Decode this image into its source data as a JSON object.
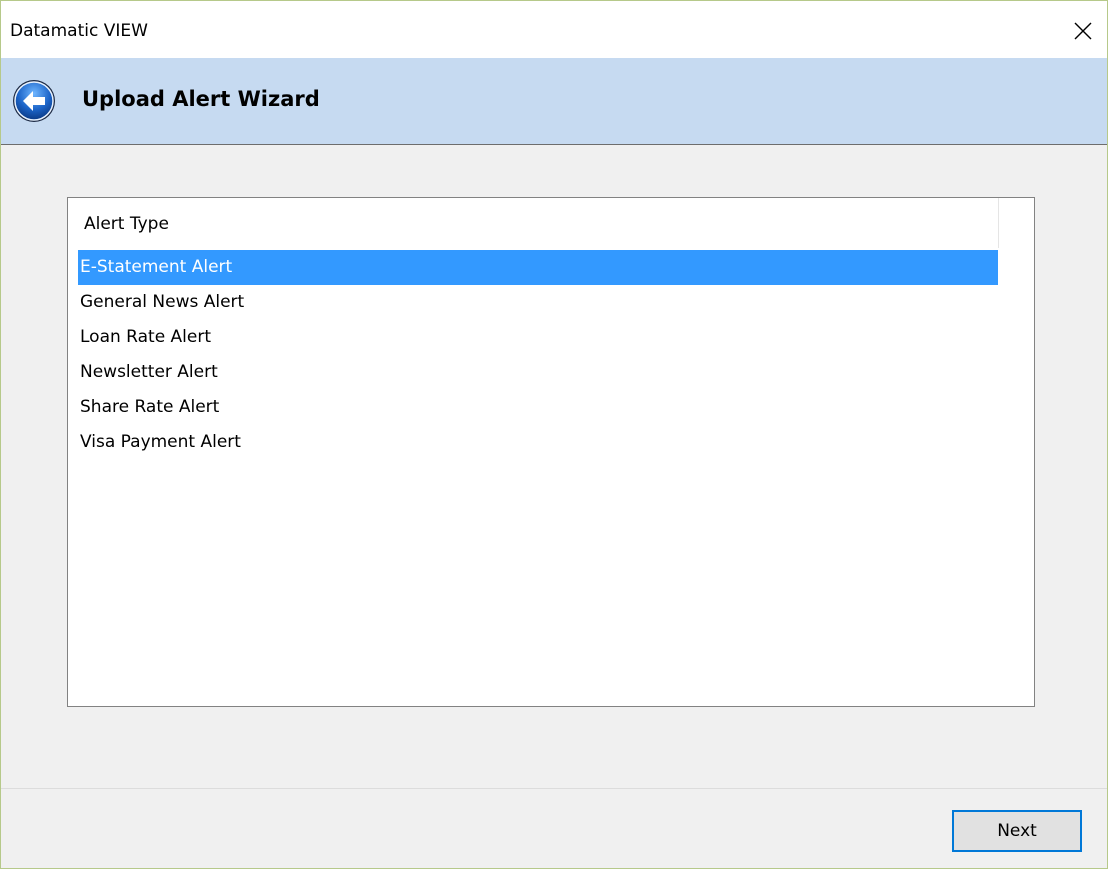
{
  "window": {
    "title": "Datamatic VIEW"
  },
  "header": {
    "title": "Upload Alert Wizard",
    "back_icon": "back-arrow-icon",
    "close_icon": "close-icon"
  },
  "list": {
    "column_header": "Alert Type",
    "items": [
      {
        "label": "E-Statement Alert",
        "selected": true
      },
      {
        "label": "General News Alert",
        "selected": false
      },
      {
        "label": "Loan Rate Alert",
        "selected": false
      },
      {
        "label": "Newsletter Alert",
        "selected": false
      },
      {
        "label": "Share Rate Alert",
        "selected": false
      },
      {
        "label": "Visa Payment Alert",
        "selected": false
      }
    ],
    "selection_color": "#3399ff"
  },
  "footer": {
    "next_label": "Next"
  },
  "colors": {
    "header_band": "#c6daf1",
    "window_bg": "#f0f0f0",
    "focus_border": "#0078d7"
  }
}
